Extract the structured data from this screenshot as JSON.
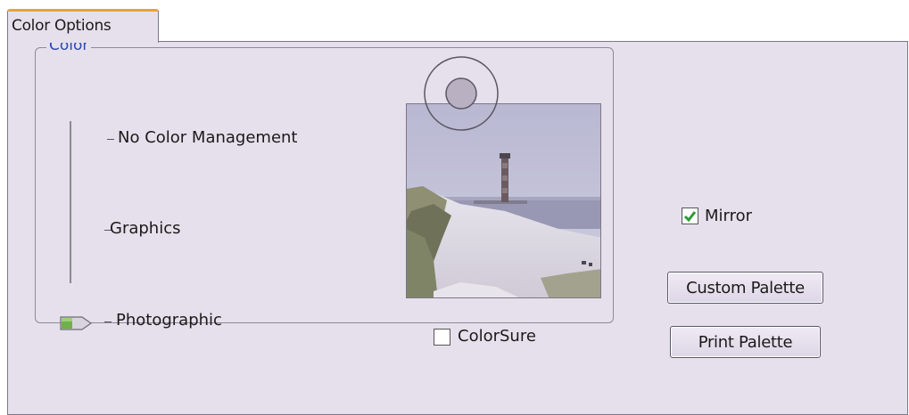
{
  "tab": {
    "label": "Color Options"
  },
  "color_group": {
    "title": "Color",
    "levels": [
      {
        "label": "No Color Management"
      },
      {
        "label": "Graphics"
      },
      {
        "label": "Photographic"
      }
    ],
    "selected_level": "Photographic"
  },
  "preview": {
    "image": "beach-lighthouse-photo"
  },
  "colorsure": {
    "label": "ColorSure",
    "checked": false
  },
  "mirror": {
    "label": "Mirror",
    "checked": true
  },
  "buttons": {
    "custom_palette": "Custom Palette",
    "print_palette": "Print Palette"
  },
  "colors": {
    "panel_bg": "#e6e0ec",
    "tab_accent": "#e8a23a",
    "group_title": "#2b47b0",
    "slider_thumb": "#6fb14a",
    "checkmark": "#2e9b38"
  }
}
